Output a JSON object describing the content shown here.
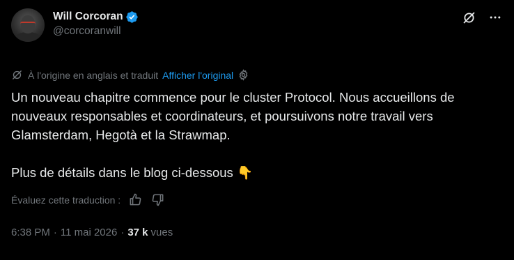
{
  "author": {
    "display_name": "Will Corcoran",
    "handle": "@corcoranwill",
    "verified_color": "#1d9bf0"
  },
  "translation": {
    "note": "À l'origine en anglais et traduit",
    "show_original": "Afficher l'original"
  },
  "tweet": {
    "paragraph1": "Un nouveau chapitre commence pour le cluster Protocol. Nous accueillons de nouveaux responsables et coordinateurs, et poursuivons notre travail vers Glamsterdam, Hegotà et la Strawmap.",
    "paragraph2": "Plus de détails dans le blog ci-dessous 👇"
  },
  "rate": {
    "label": "Évaluez cette traduction :"
  },
  "meta": {
    "time": "6:38 PM",
    "separator": "·",
    "date": "11 mai 2026",
    "views_count": "37 k",
    "views_label": "vues"
  },
  "colors": {
    "background": "#000000",
    "text": "#e7e9ea",
    "secondary": "#71767b",
    "link": "#1d9bf0"
  }
}
